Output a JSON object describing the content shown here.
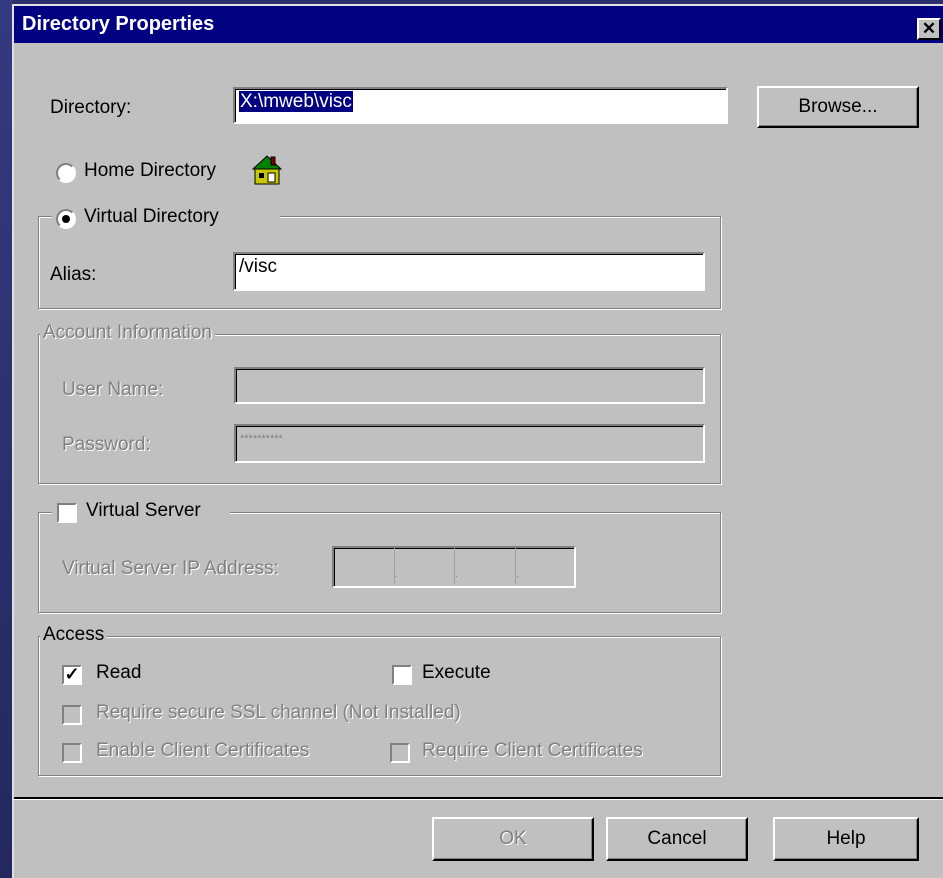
{
  "dialog": {
    "title": "Directory Properties",
    "close_symbol": "✕"
  },
  "directory": {
    "label": "Directory:",
    "value": "X:\\mweb\\visc",
    "browse_label": "Browse..."
  },
  "home_directory": {
    "label": "Home Directory",
    "selected": false,
    "icon": "home-folder-icon"
  },
  "virtual_directory": {
    "label": "Virtual Directory",
    "selected": true,
    "alias_label": "Alias:",
    "alias_value": "/visc"
  },
  "account": {
    "legend": "Account Information",
    "user_name_label": "User Name:",
    "user_name_value": "",
    "password_label": "Password:",
    "password_value": "**********"
  },
  "virtual_server": {
    "label": "Virtual Server",
    "checked": false,
    "ip_label": "Virtual Server IP Address:",
    "ip_separators": [
      ".",
      ".",
      "."
    ]
  },
  "access": {
    "legend": "Access",
    "read": {
      "label": "Read",
      "checked": true
    },
    "execute": {
      "label": "Execute",
      "checked": false
    },
    "ssl": {
      "label": "Require secure SSL channel (Not Installed)",
      "checked": false
    },
    "enable_client_certs": {
      "label": "Enable Client Certificates",
      "checked": false
    },
    "require_client_certs": {
      "label": "Require Client Certificates",
      "checked": false
    }
  },
  "buttons": {
    "ok": "OK",
    "cancel": "Cancel",
    "help": "Help"
  },
  "check_mark": "✓",
  "colors": {
    "titlebar": "#000080",
    "face": "#c0c0c0",
    "selection": "#000080"
  }
}
